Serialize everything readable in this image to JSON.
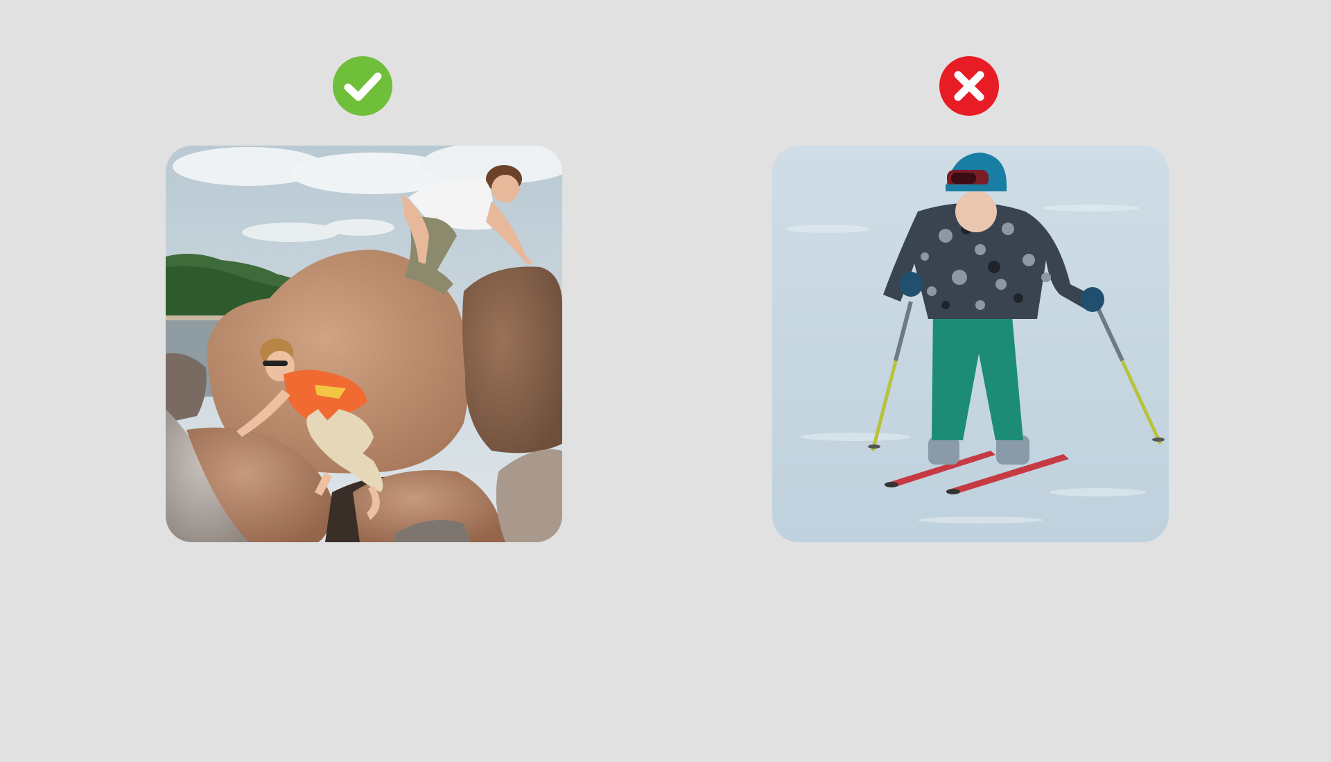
{
  "options": [
    {
      "verdict": "correct",
      "badge_icon": "check-circle-icon",
      "badge_color": "#6fbf3a",
      "photo_subject": "children-climbing-rocks-photo"
    },
    {
      "verdict": "incorrect",
      "badge_icon": "x-circle-icon",
      "badge_color": "#e81c24",
      "photo_subject": "child-skiing-photo"
    }
  ]
}
